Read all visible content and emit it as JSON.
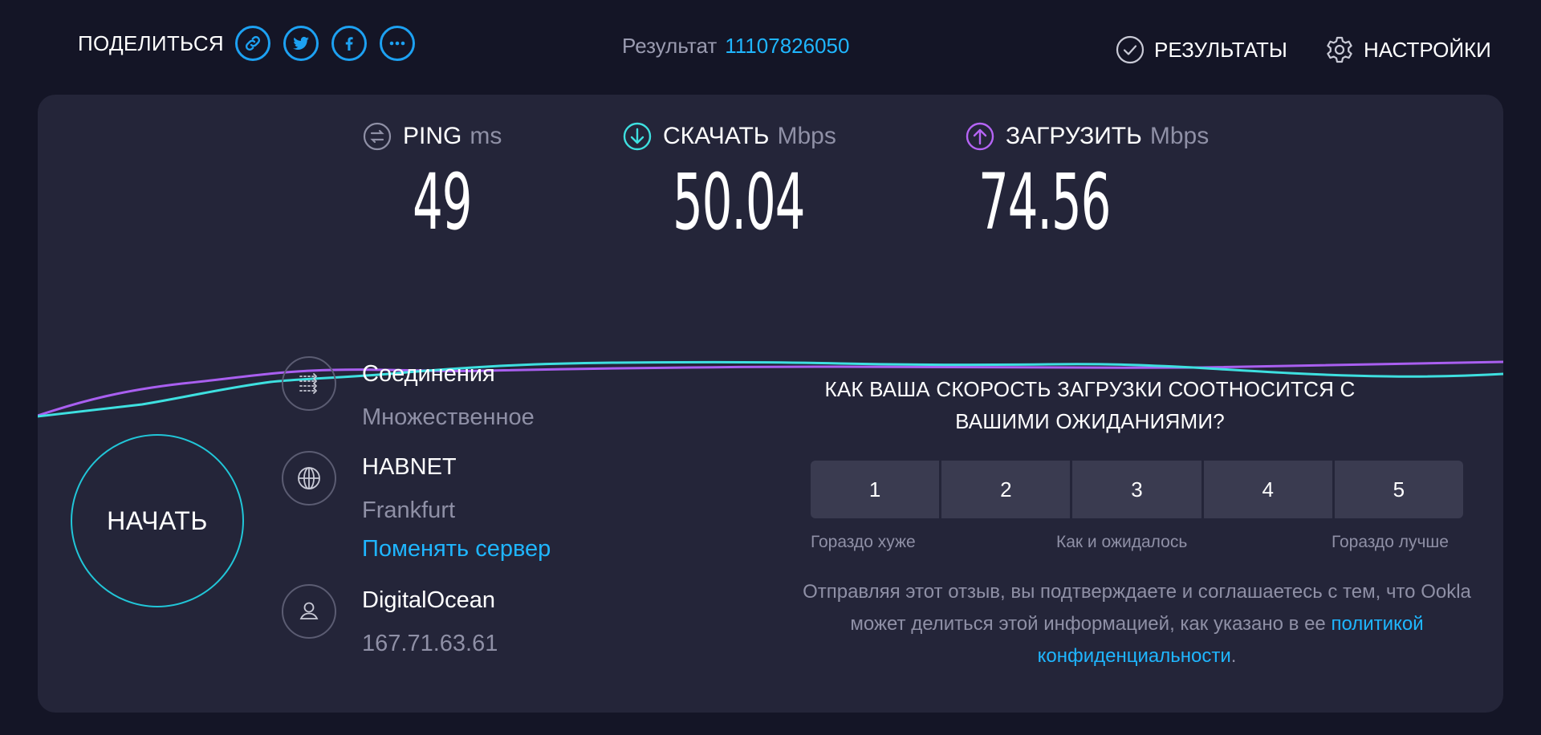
{
  "header": {
    "share_label": "ПОДЕЛИТЬСЯ",
    "share_buttons": [
      "link-icon",
      "twitter-icon",
      "facebook-icon",
      "more-icon"
    ],
    "result_label": "Результат",
    "result_id": "11107826050",
    "results_label": "РЕЗУЛЬТАТЫ",
    "settings_label": "НАСТРОЙКИ"
  },
  "metrics": {
    "ping": {
      "label": "PING",
      "unit": "ms",
      "value": "49",
      "icon": "ping-icon"
    },
    "download": {
      "label": "СКАЧАТЬ",
      "unit": "Mbps",
      "value": "50.04",
      "icon": "download-icon"
    },
    "upload": {
      "label": "ЗАГРУЗИТЬ",
      "unit": "Mbps",
      "value": "74.56",
      "icon": "upload-icon"
    }
  },
  "start_button": "НАЧАТЬ",
  "connection": {
    "label": "Соединения",
    "value": "Множественное"
  },
  "server": {
    "isp": "HABNET",
    "location": "Frankfurt",
    "change_link": "Поменять сервер"
  },
  "host": {
    "name": "DigitalOcean",
    "ip": "167.71.63.61"
  },
  "feedback": {
    "question": "КАК ВАША СКОРОСТЬ ЗАГРУЗКИ СООТНОСИТСЯ С ВАШИМИ ОЖИДАНИЯМИ?",
    "ratings": [
      "1",
      "2",
      "3",
      "4",
      "5"
    ],
    "label_low": "Гораздо хуже",
    "label_mid": "Как и ожидалось",
    "label_high": "Гораздо лучше",
    "note": "Отправляя этот отзыв, вы подтверждаете и соглашаетесь с тем, что Ookla может делиться этой информацией, как указано в ее",
    "note_link": "политикой конфиденциальности",
    "note_end": "."
  },
  "colors": {
    "background": "#141526",
    "panel": "#242539",
    "accent_blue": "#1fb6ff",
    "download_line": "#3ee0e0",
    "upload_line": "#a95ff0"
  }
}
